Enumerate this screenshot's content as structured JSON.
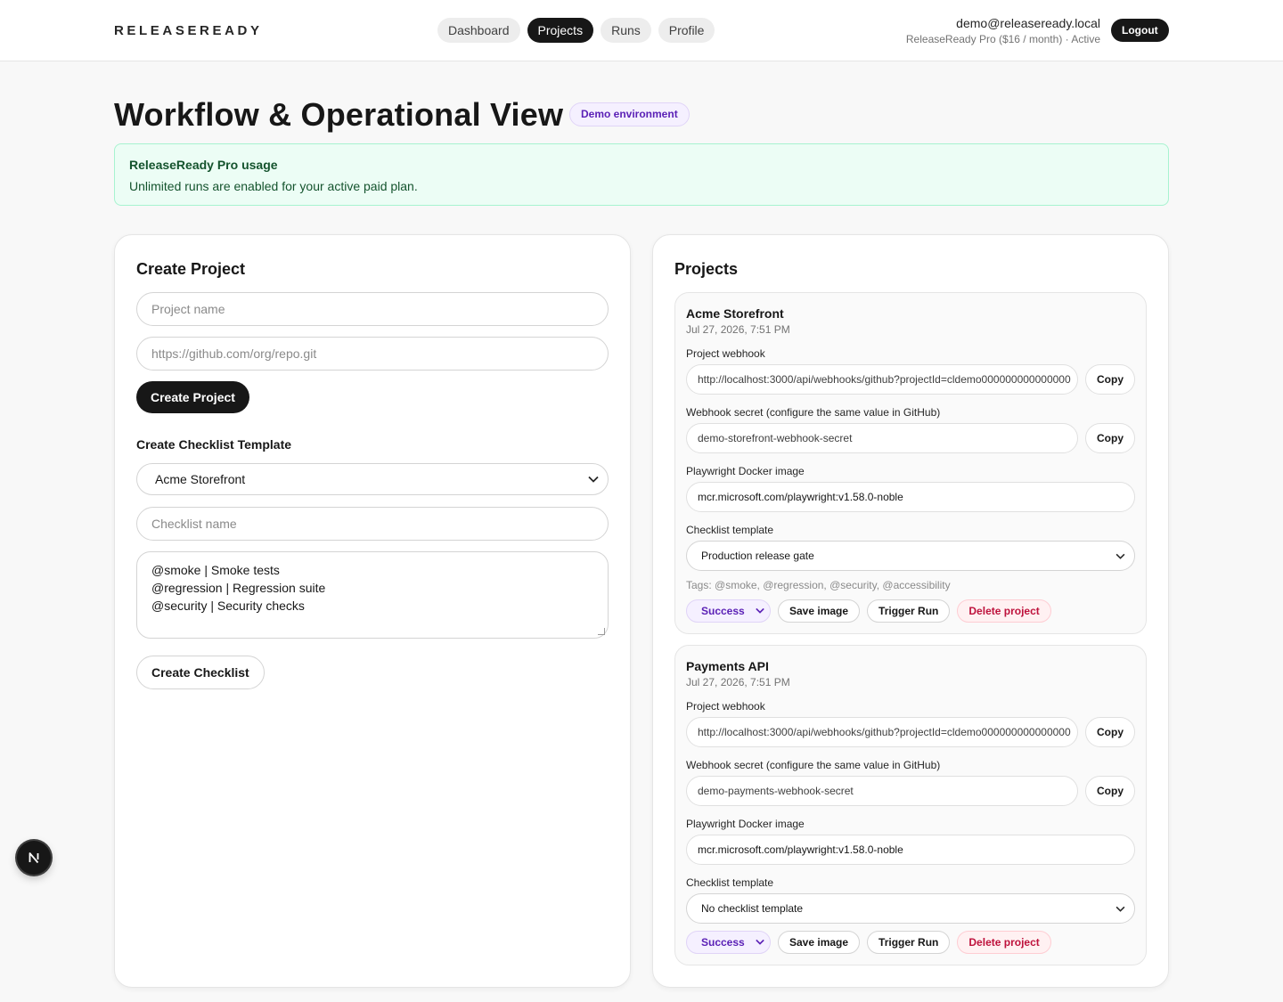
{
  "brand": "RELEASEREADY",
  "nav": {
    "items": [
      {
        "label": "Dashboard",
        "active": false
      },
      {
        "label": "Projects",
        "active": true
      },
      {
        "label": "Runs",
        "active": false
      },
      {
        "label": "Profile",
        "active": false
      }
    ]
  },
  "user": {
    "email": "demo@releaseready.local",
    "plan": "ReleaseReady Pro ($16 / month) · Active",
    "logout_label": "Logout"
  },
  "page": {
    "title": "Workflow & Operational View",
    "env_badge": "Demo environment"
  },
  "usage": {
    "title": "ReleaseReady Pro usage",
    "text": "Unlimited runs are enabled for your active paid plan."
  },
  "create_project": {
    "title": "Create Project",
    "name_placeholder": "Project name",
    "repo_placeholder": "https://github.com/org/repo.git",
    "submit_label": "Create Project"
  },
  "create_checklist": {
    "title": "Create Checklist Template",
    "project_selected": "Acme Storefront",
    "name_placeholder": "Checklist name",
    "items": [
      "@smoke | Smoke tests",
      "@regression | Regression suite",
      "@security | Security checks"
    ],
    "submit_label": "Create Checklist"
  },
  "projects": {
    "title": "Projects",
    "labels": {
      "webhook": "Project webhook",
      "secret": "Webhook secret (configure the same value in GitHub)",
      "docker": "Playwright Docker image",
      "checklist": "Checklist template",
      "copy": "Copy",
      "save_image": "Save image",
      "trigger_run": "Trigger Run",
      "delete": "Delete project"
    },
    "items": [
      {
        "name": "Acme Storefront",
        "date": "Jul 27, 2026, 7:51 PM",
        "webhook": "http://localhost:3000/api/webhooks/github?projectId=cldemo000000000000000",
        "secret": "demo-storefront-webhook-secret",
        "docker_image": "mcr.microsoft.com/playwright:v1.58.0-noble",
        "checklist": "Production release gate",
        "tags": "Tags: @smoke, @regression, @security, @accessibility",
        "status": "Success"
      },
      {
        "name": "Payments API",
        "date": "Jul 27, 2026, 7:51 PM",
        "webhook": "http://localhost:3000/api/webhooks/github?projectId=cldemo000000000000000",
        "secret": "demo-payments-webhook-secret",
        "docker_image": "mcr.microsoft.com/playwright:v1.58.0-noble",
        "checklist": "No checklist template",
        "status": "Success"
      }
    ]
  },
  "next_badge": {
    "letter": "N"
  }
}
